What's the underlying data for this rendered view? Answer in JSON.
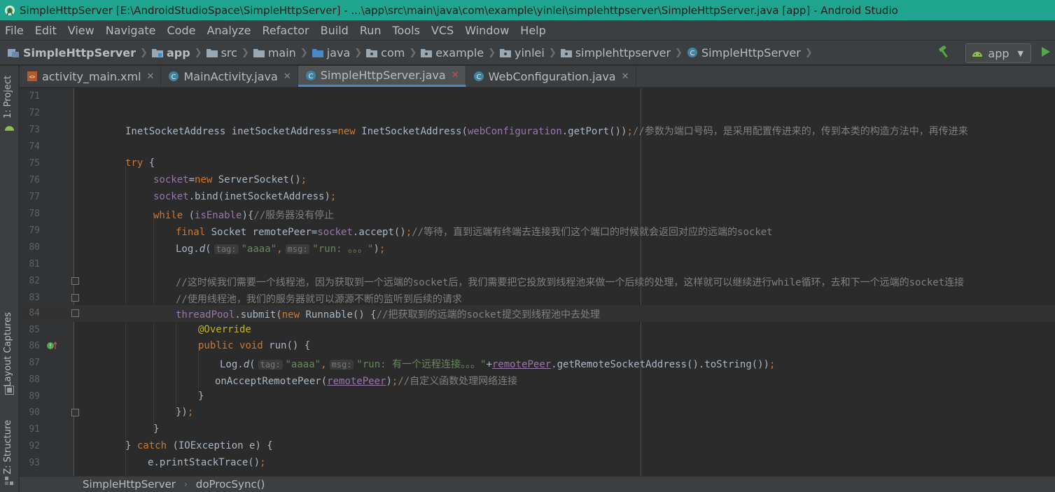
{
  "window": {
    "title": "SimpleHttpServer [E:\\AndroidStudioSpace\\SimpleHttpServer] - ...\\app\\src\\main\\java\\com\\example\\yinlei\\simplehttpserver\\SimpleHttpServer.java [app] - Android Studio",
    "accent": "#1fa58f"
  },
  "menu": [
    "File",
    "Edit",
    "View",
    "Navigate",
    "Code",
    "Analyze",
    "Refactor",
    "Build",
    "Run",
    "Tools",
    "VCS",
    "Window",
    "Help"
  ],
  "breadcrumb": [
    {
      "label": "SimpleHttpServer",
      "icon": "project-icon"
    },
    {
      "label": "app",
      "icon": "module-folder-icon"
    },
    {
      "label": "src",
      "icon": "folder-icon"
    },
    {
      "label": "main",
      "icon": "folder-icon"
    },
    {
      "label": "java",
      "icon": "source-folder-icon"
    },
    {
      "label": "com",
      "icon": "package-icon"
    },
    {
      "label": "example",
      "icon": "package-icon"
    },
    {
      "label": "yinlei",
      "icon": "package-icon"
    },
    {
      "label": "simplehttpserver",
      "icon": "package-icon"
    },
    {
      "label": "SimpleHttpServer",
      "icon": "class-icon"
    }
  ],
  "run_config": {
    "label": "app"
  },
  "side_tabs": {
    "project": "1: Project",
    "captures": "Layout Captures",
    "structure": "Z: Structure"
  },
  "tabs": [
    {
      "label": "activity_main.xml",
      "icon": "xml-file-icon",
      "active": false
    },
    {
      "label": "MainActivity.java",
      "icon": "class-icon",
      "active": false
    },
    {
      "label": "SimpleHttpServer.java",
      "icon": "class-icon",
      "active": true
    },
    {
      "label": "WebConfiguration.java",
      "icon": "class-icon",
      "active": false
    }
  ],
  "line_numbers": [
    "71",
    "72",
    "73",
    "74",
    "75",
    "76",
    "77",
    "78",
    "79",
    "80",
    "81",
    "82",
    "83",
    "84",
    "85",
    "86",
    "87",
    "88",
    "89",
    "90",
    "91",
    "92",
    "93"
  ],
  "code": {
    "l73": {
      "a": "InetSocketAddress inetSocketAddress=",
      "b": "new",
      "c": " InetSocketAddress(",
      "d": "webConfiguration",
      "e": ".getPort())",
      "f": ";",
      "g": "//参数为端口号码，是采用配置传进来的，传到本类的构造方法中，再传进来"
    },
    "l75": {
      "a": "try",
      "b": " {"
    },
    "l76": {
      "a": "socket",
      "b": "=",
      "c": "new",
      "d": " ServerSocket()",
      "e": ";"
    },
    "l77": {
      "a": "socket",
      "b": ".bind(inetSocketAddress)",
      "c": ";"
    },
    "l78": {
      "a": "while",
      "b": " (",
      "c": "isEnable",
      "d": "){",
      "e": "//服务器没有停止"
    },
    "l79": {
      "a": "final",
      "b": " Socket remotePeer=",
      "c": "socket",
      "d": ".accept()",
      "e": ";",
      "f": "//等待，直到远端有终端去连接我们这个端口的时候就会返回对应的远端的socket"
    },
    "l80": {
      "a": "Log.",
      "b": "d",
      "c": "(",
      "h1": "tag:",
      "s1": "\"aaaa\"",
      "c2": ",",
      "h2": "msg:",
      "s2": "\"run: 。。。\"",
      "e": ")",
      "f": ";"
    },
    "l82": "//这时候我们需要一个线程池，因为获取到一个远端的socket后，我们需要把它投放到线程池来做一个后续的处理，这样就可以继续进行while循环，去和下一个远端的socket连接",
    "l83": "//使用线程池，我们的服务器就可以源源不断的监听到后续的请求",
    "l84": {
      "a": "threadPool",
      "b": ".submit(",
      "c": "new",
      "d": " Runnable() {",
      "e": "//把获取到的远端的socket提交到线程池中去处理"
    },
    "l85": "@Override",
    "l86": {
      "a": "public",
      "b": " ",
      "c": "void",
      "d": " run() {"
    },
    "l87": {
      "a": "Log.",
      "b": "d",
      "c": "(",
      "h1": "tag:",
      "s1": "\"aaaa\"",
      "c2": ",",
      "h2": "msg:",
      "s2": "\"run: 有一个远程连接。。。\"",
      "p": "+",
      "r": "remotePeer",
      "e": ".getRemoteSocketAddress().toString())",
      "f": ";"
    },
    "l88": {
      "a": "onAcceptRemotePeer(",
      "r": "remotePeer",
      "b": ")",
      "c": ";",
      "d": "//自定义函数处理网络连接"
    },
    "l89": "}",
    "l90": {
      "a": "})",
      "b": ";"
    },
    "l91": "}",
    "l92": {
      "a": "} ",
      "b": "catch",
      "c": " (IOException e) {"
    },
    "l93": {
      "a": "e.printStackTrace()",
      "b": ";"
    }
  },
  "status": {
    "cls": "SimpleHttpServer",
    "method": "doProcSync()"
  },
  "colors": {
    "keyword": "#cc7832",
    "field": "#9876aa",
    "string": "#6a8759",
    "comment": "#808080",
    "annotation": "#bbb529"
  }
}
